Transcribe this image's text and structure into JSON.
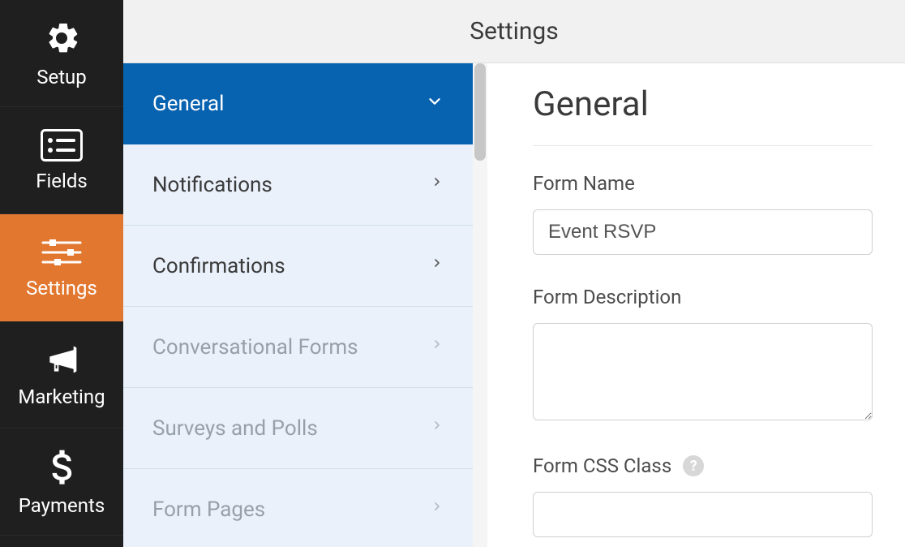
{
  "nav": {
    "items": [
      {
        "id": "setup",
        "label": "Setup",
        "active": false,
        "icon": "gear-icon"
      },
      {
        "id": "fields",
        "label": "Fields",
        "active": false,
        "icon": "list-icon"
      },
      {
        "id": "settings",
        "label": "Settings",
        "active": true,
        "icon": "sliders-icon"
      },
      {
        "id": "marketing",
        "label": "Marketing",
        "active": false,
        "icon": "bullhorn-icon"
      },
      {
        "id": "payments",
        "label": "Payments",
        "active": false,
        "icon": "dollar-icon"
      }
    ]
  },
  "topbar": {
    "title": "Settings"
  },
  "submenu": {
    "items": [
      {
        "label": "General",
        "active": true,
        "dim": false,
        "chevron": "down"
      },
      {
        "label": "Notifications",
        "active": false,
        "dim": false,
        "chevron": "right"
      },
      {
        "label": "Confirmations",
        "active": false,
        "dim": false,
        "chevron": "right"
      },
      {
        "label": "Conversational Forms",
        "active": false,
        "dim": true,
        "chevron": "right"
      },
      {
        "label": "Surveys and Polls",
        "active": false,
        "dim": true,
        "chevron": "right"
      },
      {
        "label": "Form Pages",
        "active": false,
        "dim": true,
        "chevron": "right"
      }
    ]
  },
  "content": {
    "heading": "General",
    "form_name_label": "Form Name",
    "form_name_value": "Event RSVP",
    "form_description_label": "Form Description",
    "form_description_value": "",
    "form_css_label": "Form CSS Class",
    "form_css_value": ""
  },
  "colors": {
    "nav_bg": "#1f1f1f",
    "nav_active_bg": "#e27730",
    "submenu_bg": "#eaf1fb",
    "submenu_active_bg": "#0762b0"
  }
}
